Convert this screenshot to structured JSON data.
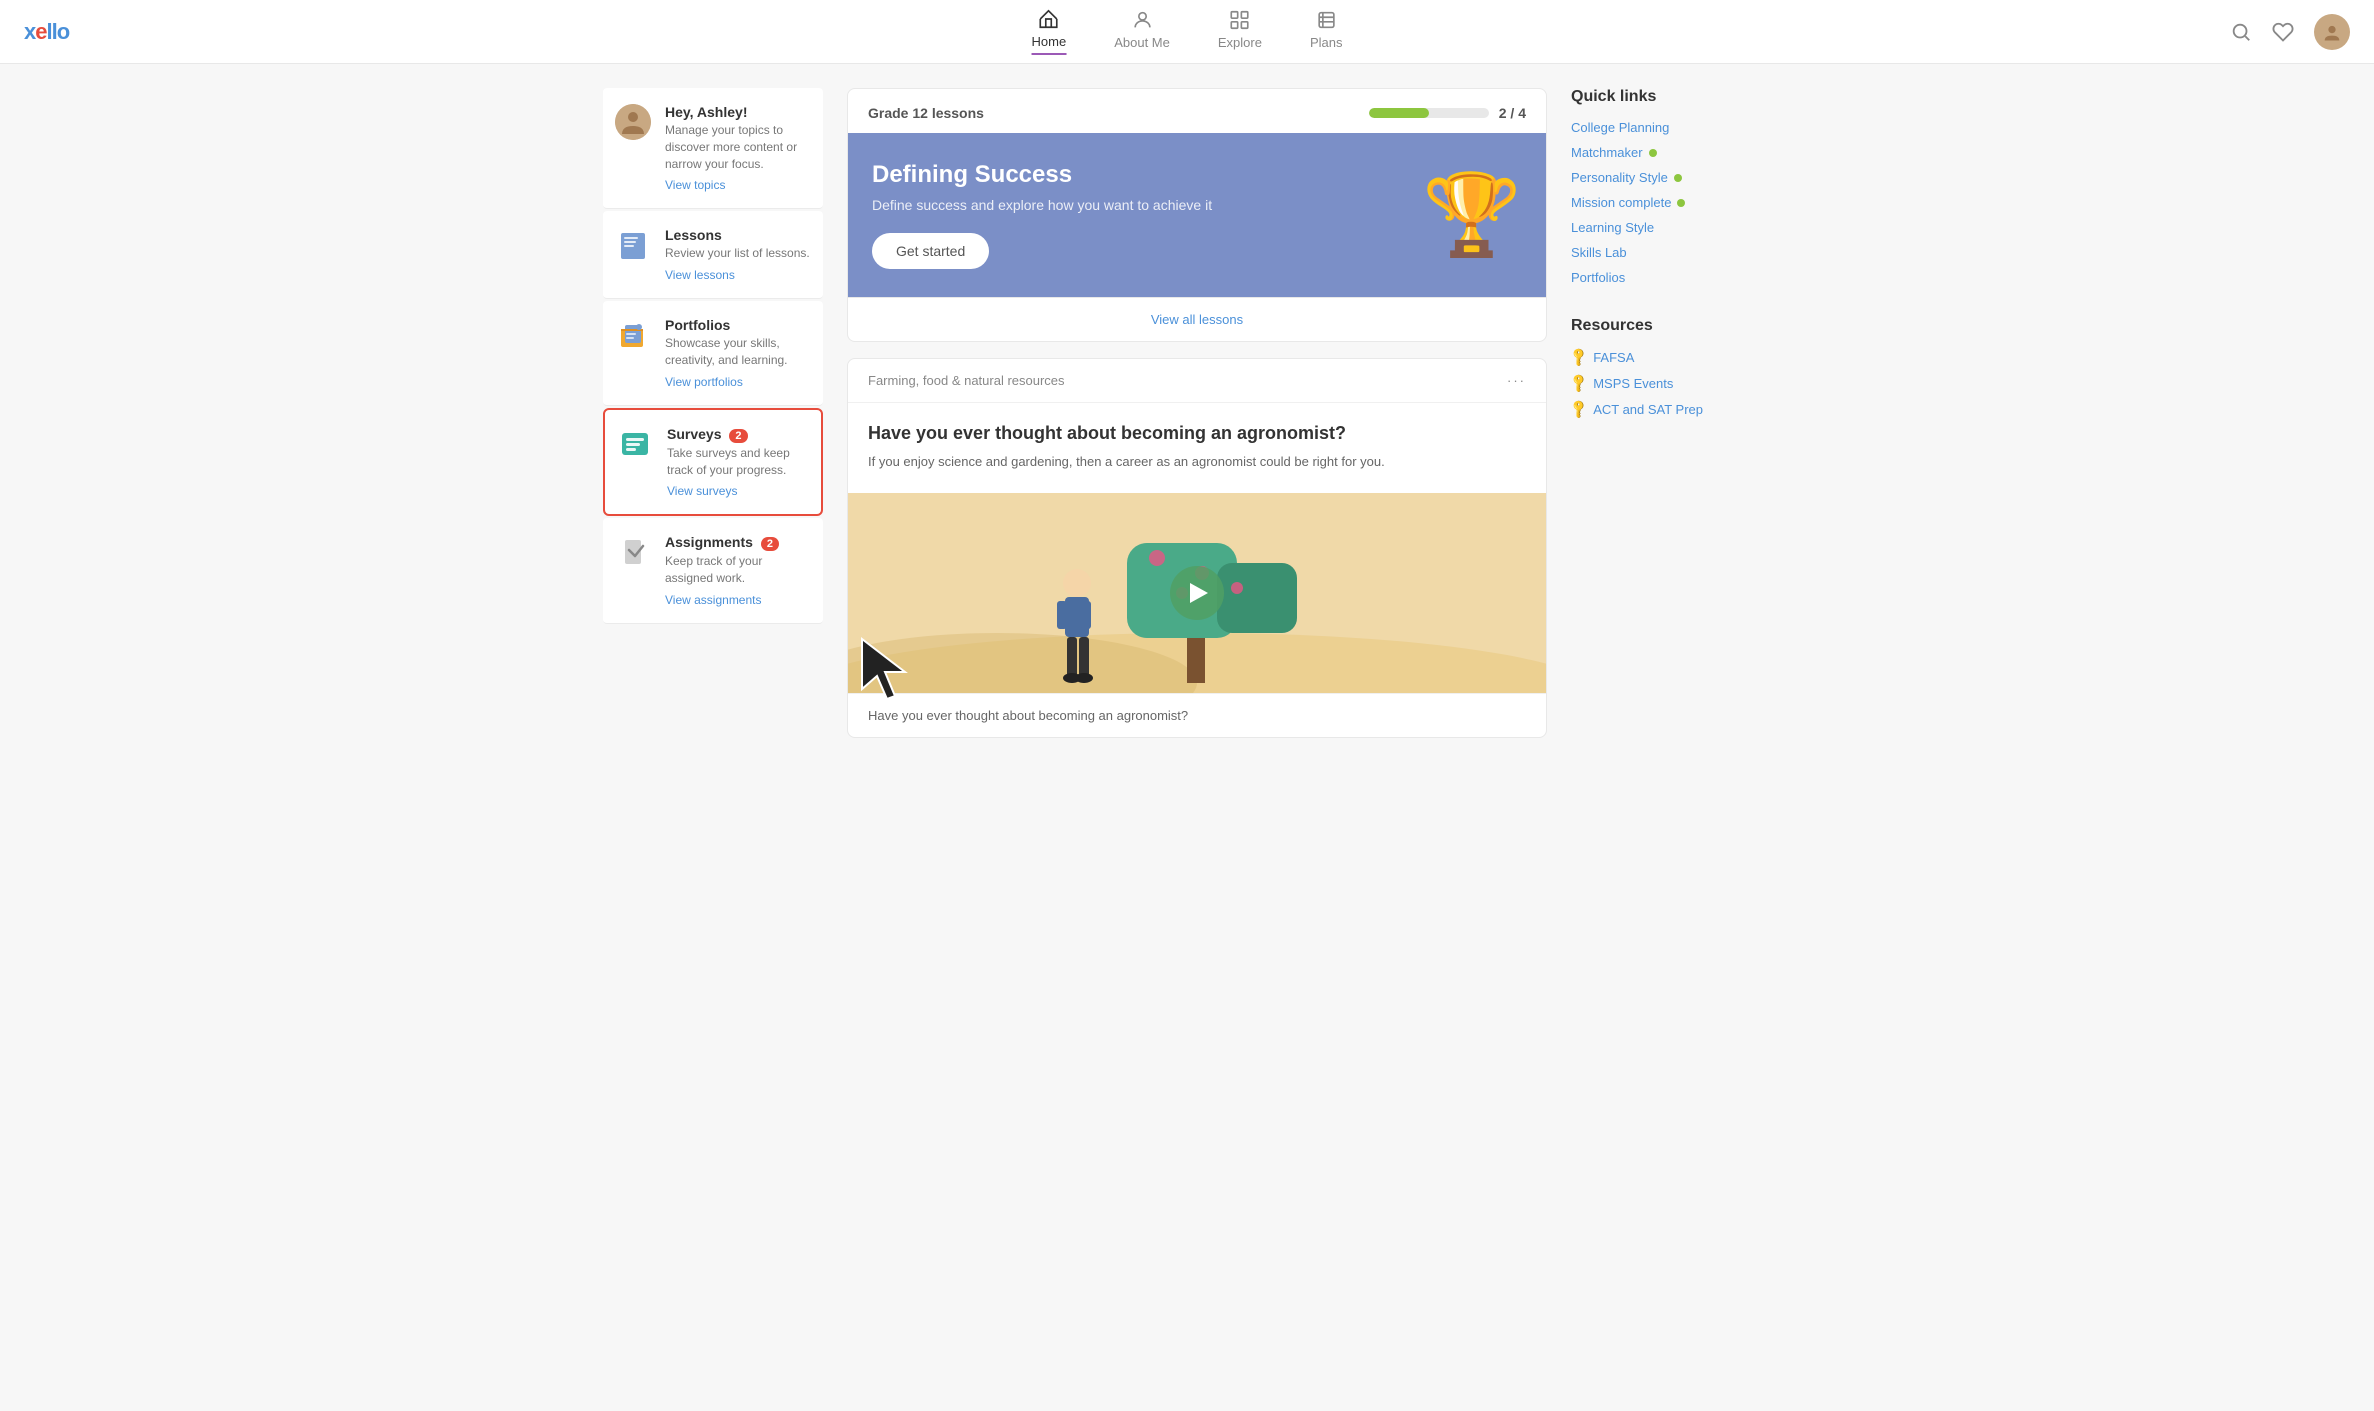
{
  "header": {
    "logo": "xello",
    "nav": [
      {
        "id": "home",
        "label": "Home",
        "active": true
      },
      {
        "id": "about-me",
        "label": "About Me",
        "active": false
      },
      {
        "id": "explore",
        "label": "Explore",
        "active": false
      },
      {
        "id": "plans",
        "label": "Plans",
        "active": false
      }
    ]
  },
  "sidebar": {
    "greeting": {
      "title": "Hey, Ashley!",
      "desc": "Manage your topics to discover more content or narrow your focus.",
      "link": "View topics"
    },
    "lessons": {
      "title": "Lessons",
      "desc": "Review your list of lessons.",
      "link": "View lessons"
    },
    "portfolios": {
      "title": "Portfolios",
      "desc": "Showcase your skills, creativity, and learning.",
      "link": "View portfolios"
    },
    "surveys": {
      "title": "Surveys",
      "badge": "2",
      "desc": "Take surveys and keep track of your progress.",
      "link": "View surveys"
    },
    "assignments": {
      "title": "Assignments",
      "badge": "2",
      "desc": "Keep track of your assigned work.",
      "link": "View assignments"
    }
  },
  "lessons_card": {
    "grade_label": "Grade 12 lessons",
    "progress_current": 2,
    "progress_total": 4,
    "progress_percent": 50,
    "hero": {
      "title": "Defining Success",
      "desc": "Define success and explore how you want to achieve it",
      "cta": "Get started"
    },
    "view_all": "View all lessons"
  },
  "career_card": {
    "tag": "Farming, food & natural resources",
    "title": "Have you ever thought about becoming an agronomist?",
    "desc": "If you enjoy science and gardening, then a career as an agronomist could be right for you.",
    "bottom_text": "Have you ever thought about becoming an agronomist?"
  },
  "quick_links": {
    "heading": "Quick links",
    "items": [
      {
        "label": "College Planning",
        "dot": false
      },
      {
        "label": "Matchmaker",
        "dot": true
      },
      {
        "label": "Personality Style",
        "dot": true
      },
      {
        "label": "Mission complete",
        "dot": true
      },
      {
        "label": "Learning Style",
        "dot": false
      },
      {
        "label": "Skills Lab",
        "dot": false
      },
      {
        "label": "Portfolios",
        "dot": false
      }
    ]
  },
  "resources": {
    "heading": "Resources",
    "items": [
      {
        "label": "FAFSA"
      },
      {
        "label": "MSPS Events"
      },
      {
        "label": "ACT and SAT Prep"
      }
    ]
  }
}
